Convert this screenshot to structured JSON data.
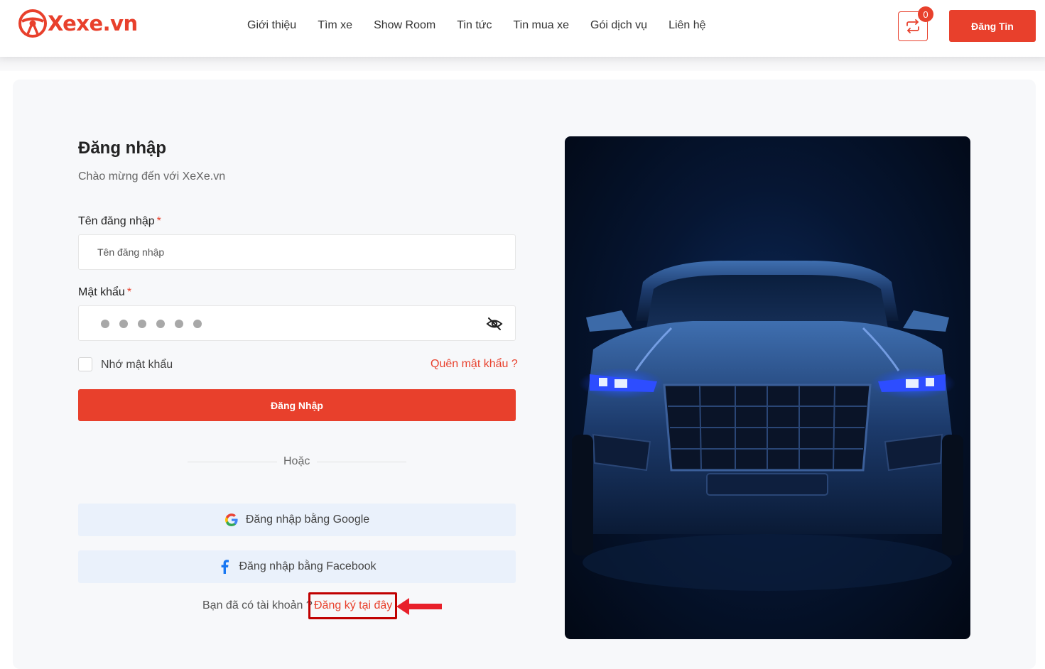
{
  "brand": {
    "name": "Xexe.vn",
    "accent": "#e8402c"
  },
  "nav": [
    "Giới thiệu",
    "Tìm xe",
    "Show Room",
    "Tin tức",
    "Tin mua xe",
    "Gói dịch vụ",
    "Liên hệ"
  ],
  "header": {
    "compare_count": "0",
    "post_label": "Đăng Tin"
  },
  "login": {
    "title": "Đăng nhập",
    "subtitle": "Chào mừng đến với XeXe.vn",
    "username_label": "Tên đăng nhập",
    "username_placeholder": "Tên đăng nhập",
    "required_mark": "*",
    "password_label": "Mật khẩu",
    "remember_label": "Nhớ mật khẩu",
    "forgot_label": "Quên mật khẩu ?",
    "submit_label": "Đăng Nhập",
    "or_label": "Hoặc",
    "google_label": "Đăng nhập bằng Google",
    "facebook_label": "Đăng nhập bằng Facebook",
    "register_prompt": "Bạn đã có tài khoản ?",
    "register_link": "Đăng ký tại đây"
  },
  "icons": [
    "steering-wheel-icon",
    "compare-icon",
    "eye-slash-icon",
    "google-icon",
    "facebook-icon",
    "arrow-left-icon"
  ]
}
